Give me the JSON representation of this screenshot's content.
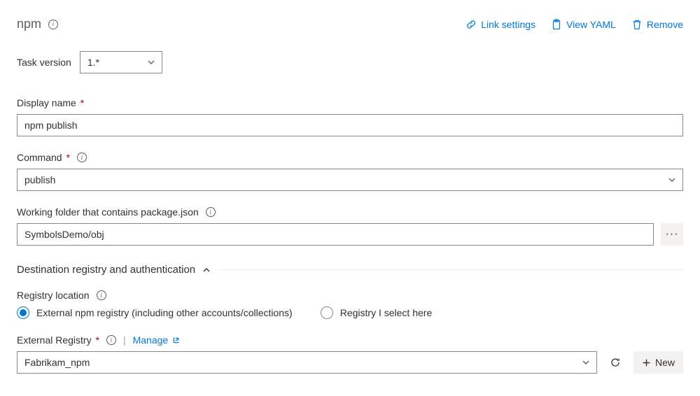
{
  "header": {
    "title": "npm",
    "link_settings": "Link settings",
    "view_yaml": "View YAML",
    "remove": "Remove"
  },
  "task_version": {
    "label": "Task version",
    "value": "1.*"
  },
  "display_name": {
    "label": "Display name",
    "value": "npm publish"
  },
  "command": {
    "label": "Command",
    "value": "publish"
  },
  "working_folder": {
    "label": "Working folder that contains package.json",
    "value": "SymbolsDemo/obj"
  },
  "section": {
    "title": "Destination registry and authentication"
  },
  "registry_location": {
    "label": "Registry location",
    "options": {
      "external": "External npm registry (including other accounts/collections)",
      "select_here": "Registry I select here"
    }
  },
  "external_registry": {
    "label": "External Registry",
    "manage": "Manage",
    "value": "Fabrikam_npm",
    "new": "New"
  }
}
